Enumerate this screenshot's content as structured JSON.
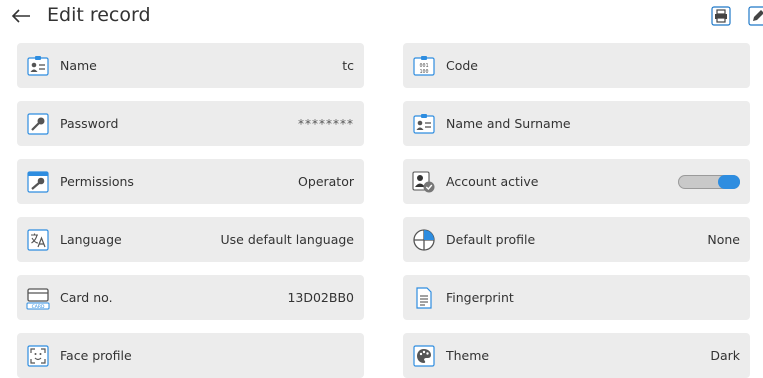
{
  "header": {
    "title": "Edit record"
  },
  "left": [
    {
      "label": "Name",
      "value": "tc"
    },
    {
      "label": "Password",
      "value": "********"
    },
    {
      "label": "Permissions",
      "value": "Operator"
    },
    {
      "label": "Language",
      "value": "Use default language"
    },
    {
      "label": "Card no.",
      "value": "13D02BB0"
    },
    {
      "label": "Face profile",
      "value": ""
    }
  ],
  "right": [
    {
      "label": "Code",
      "value": ""
    },
    {
      "label": "Name and Surname",
      "value": ""
    },
    {
      "label": "Account active",
      "value": ""
    },
    {
      "label": "Default profile",
      "value": "None"
    },
    {
      "label": "Fingerprint",
      "value": ""
    },
    {
      "label": "Theme",
      "value": "Dark"
    }
  ],
  "toggles": {
    "account_active": true
  },
  "icons": {
    "back": "arrow-left-icon",
    "print": "printer-icon",
    "edit": "edit-icon",
    "name": "id-card-icon",
    "code": "code-icon",
    "password": "key-icon",
    "name_surname": "id-card-icon",
    "permissions": "key-icon",
    "account_active": "user-check-icon",
    "language": "language-icon",
    "default_profile": "profile-icon",
    "card": "card-icon",
    "fingerprint": "document-icon",
    "face_profile": "face-icon",
    "theme": "palette-icon"
  },
  "colors": {
    "accent": "#2e8de0",
    "tile": "#ececec"
  }
}
